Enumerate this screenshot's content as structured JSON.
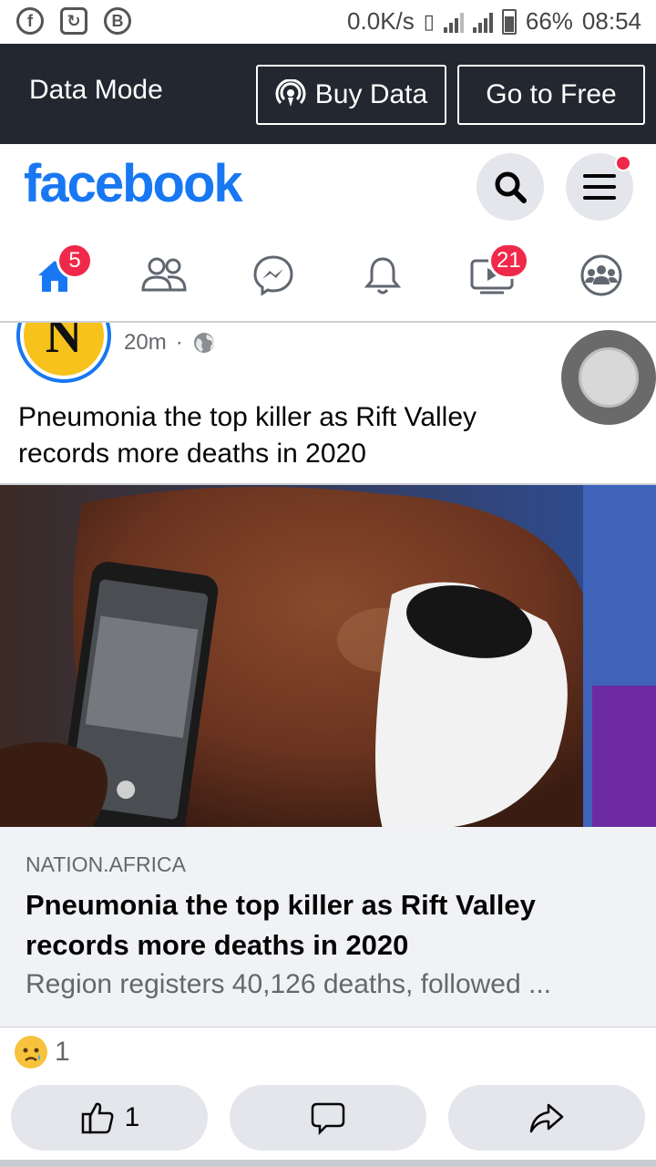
{
  "status_bar": {
    "speed": "0.0K/s",
    "battery": "66%",
    "time": "08:54",
    "left_icons": [
      "facebook-notification-icon",
      "sync-icon",
      "bitcoin-icon"
    ]
  },
  "data_bar": {
    "label": "Data Mode",
    "buy_label": "Buy Data",
    "free_label": "Go to Free"
  },
  "header": {
    "logo": "facebook"
  },
  "nav": {
    "home_badge": "5",
    "watch_badge": "21"
  },
  "post": {
    "time": "20m",
    "avatar_letter": "N",
    "text": "Pneumonia the top killer as Rift Valley records more deaths in 2020"
  },
  "link": {
    "domain": "NATION.AFRICA",
    "title": "Pneumonia the top killer as Rift Valley records more deaths in 2020",
    "description": "Region registers 40,126 deaths, followed ..."
  },
  "reactions": {
    "count": "1"
  },
  "actions": {
    "like_count": "1"
  },
  "colors": {
    "brand": "#1877f2",
    "badge": "#f02849",
    "databar": "#23272f"
  }
}
